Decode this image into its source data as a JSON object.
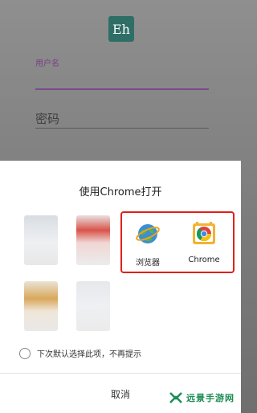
{
  "background": {
    "logo_text": "Eh",
    "username_label": "用户名",
    "password_placeholder": "密码"
  },
  "chooser": {
    "title": "使用Chrome打开",
    "apps": [
      {
        "label": "浏览器",
        "icon": "globe-browser-icon"
      },
      {
        "label": "Chrome",
        "icon": "chrome-icon"
      }
    ],
    "remember_text": "下次默认选择此项，不再提示",
    "cancel_label": "取消"
  },
  "watermark": {
    "text": "远景手游网",
    "color": "#1c8c55"
  },
  "colors": {
    "highlight_border": "#e0201a",
    "accent_purple": "#7b4a8a",
    "logo_green": "#2f6e66"
  }
}
